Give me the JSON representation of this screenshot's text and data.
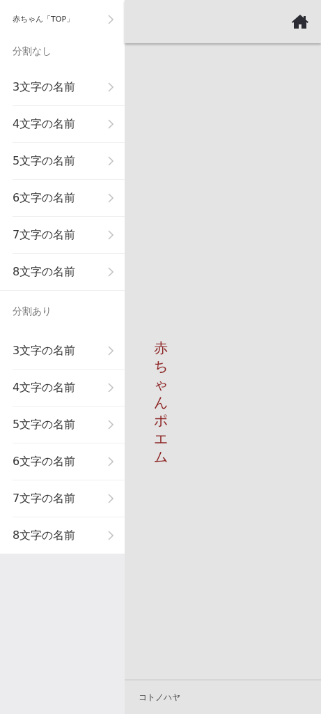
{
  "sidebar": {
    "top_item": "赤ちゃん「TOP」",
    "sections": [
      {
        "title": "分割なし",
        "items": [
          "3文字の名前",
          "4文字の名前",
          "5文字の名前",
          "6文字の名前",
          "7文字の名前",
          "8文字の名前"
        ]
      },
      {
        "title": "分割あり",
        "items": [
          "3文字の名前",
          "4文字の名前",
          "5文字の名前",
          "6文字の名前",
          "7文字の名前",
          "8文字の名前"
        ]
      }
    ]
  },
  "main": {
    "title": "赤ちゃんポエム"
  },
  "footer": {
    "text": "コトノハヤ"
  }
}
